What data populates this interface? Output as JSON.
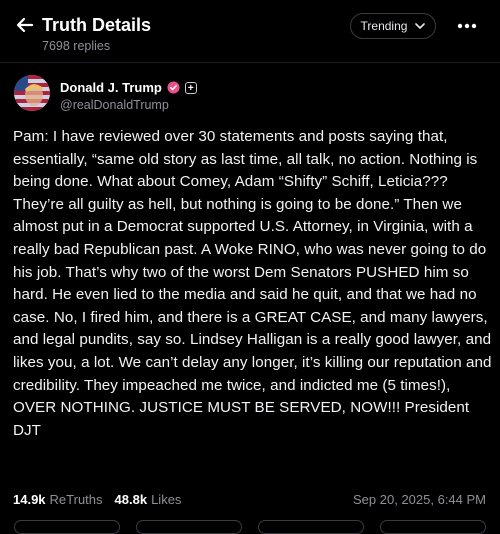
{
  "header": {
    "title": "Truth Details",
    "replies": "7698 replies",
    "sort_label": "Trending",
    "back_icon": "arrow-left-icon",
    "more_icon": "ellipsis-icon"
  },
  "author": {
    "name": "Donald J. Trump",
    "handle": "@realDonaldTrump",
    "verified_color": "#e8508a"
  },
  "post": {
    "text": "Pam: I have reviewed over 30 statements and posts saying that, essentially, “same old story as last time, all talk, no action. Nothing is being done. What about Comey, Adam “Shifty” Schiff, Leticia??? They’re all guilty as hell, but nothing is going to be done.” Then we almost put in a Democrat supported U.S. Attorney, in Virginia, with a really bad Republican past. A Woke RINO, who was never going to do his job. That’s why two of the worst Dem Senators PUSHED him so hard. He even lied to the media and said he quit, and that we had no case. No, I fired him, and there is a GREAT CASE, and many lawyers, and legal pundits, say so. Lindsey Halligan is a really good lawyer, and likes you, a lot. We can’t delay any longer, it’s killing our reputation and credibility. They impeached me twice, and indicted me (5 times!), OVER NOTHING. JUSTICE MUST BE SERVED, NOW!!! President DJT"
  },
  "stats": {
    "retruths_count": "14.9k",
    "retruths_label": "ReTruths",
    "likes_count": "48.8k",
    "likes_label": "Likes",
    "timestamp": "Sep 20, 2025, 6:44 PM"
  }
}
